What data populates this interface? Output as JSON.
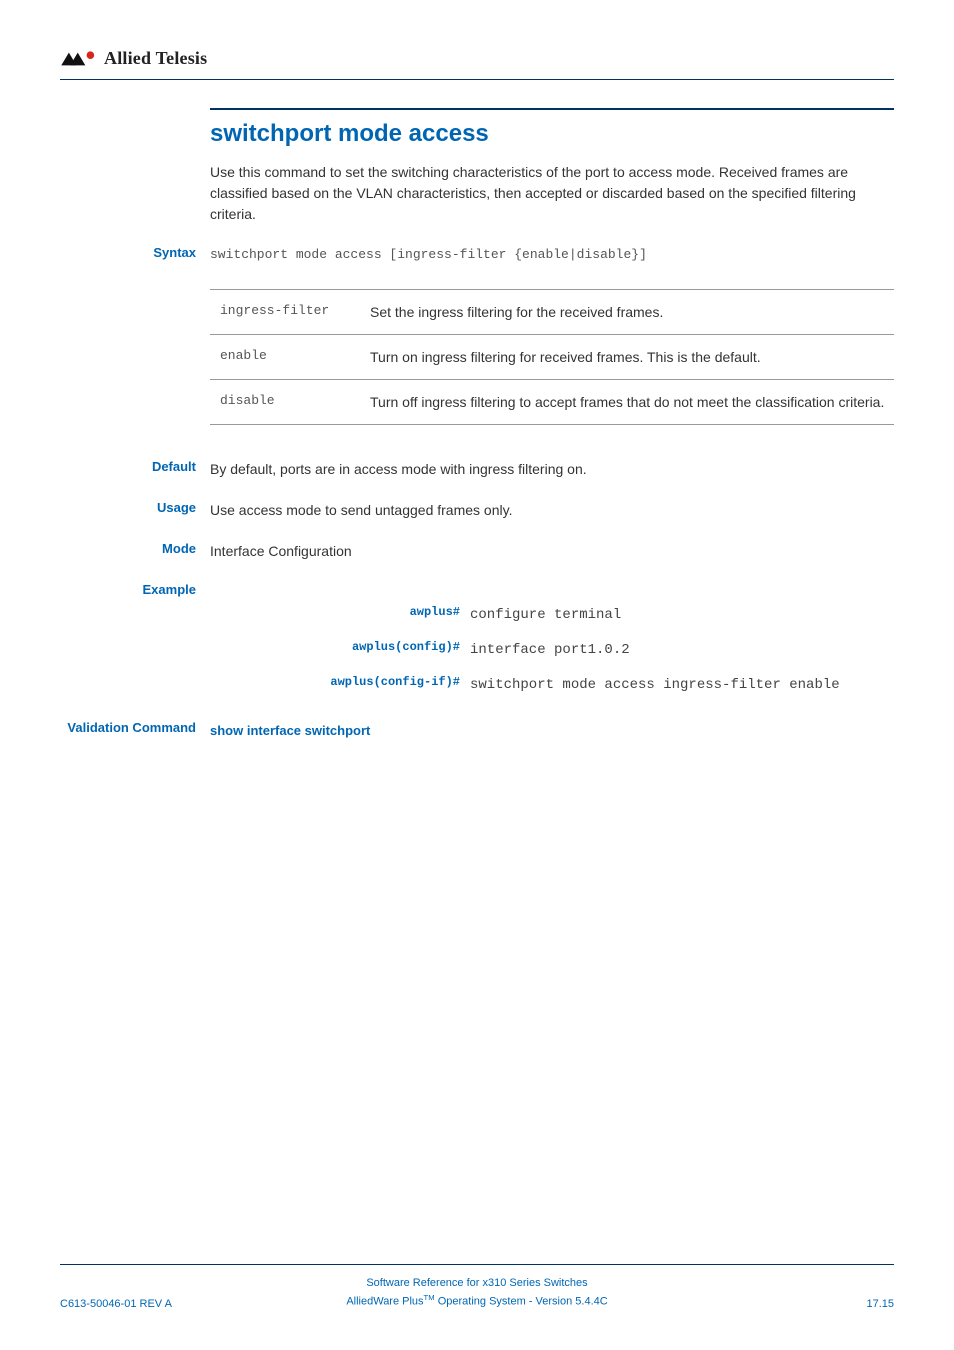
{
  "logo_text": "Allied Telesis",
  "title": "switchport mode access",
  "intro": "Use this command to set the switching characteristics of the port to access mode. Received frames are classified based on the VLAN characteristics, then accepted or discarded based on the specified filtering criteria.",
  "syntax": {
    "label": "Syntax",
    "text": "switchport mode access [ingress-filter {enable|disable}]"
  },
  "params": [
    {
      "name": "ingress-filter",
      "desc": "Set the ingress filtering for the received frames."
    },
    {
      "name": "enable",
      "desc": "Turn on ingress filtering for received frames. This is the default."
    },
    {
      "name": "disable",
      "desc": "Turn off ingress filtering to accept frames that do not meet the classification criteria."
    }
  ],
  "default": {
    "label": "Default",
    "text": "By default, ports are in access mode with ingress filtering on."
  },
  "usage": {
    "label": "Usage",
    "text": "Use access mode to send untagged frames only."
  },
  "mode": {
    "label": "Mode",
    "text": "Interface Configuration"
  },
  "example": {
    "label": "Example",
    "lines": [
      {
        "prompt": "awplus#",
        "cmd": "configure terminal"
      },
      {
        "prompt": "awplus(config)#",
        "cmd": "interface port1.0.2"
      },
      {
        "prompt": "awplus(config-if)#",
        "cmd": "switchport mode access ingress-filter enable"
      }
    ]
  },
  "validation": {
    "label": "Validation Command",
    "link": "show interface switchport"
  },
  "footer": {
    "left": "C613-50046-01 REV A",
    "center_line1": "Software Reference for x310 Series Switches",
    "center_line2_pre": "AlliedWare Plus",
    "center_line2_tm": "TM",
    "center_line2_post": " Operating System - Version 5.4.4C",
    "right": "17.15"
  }
}
